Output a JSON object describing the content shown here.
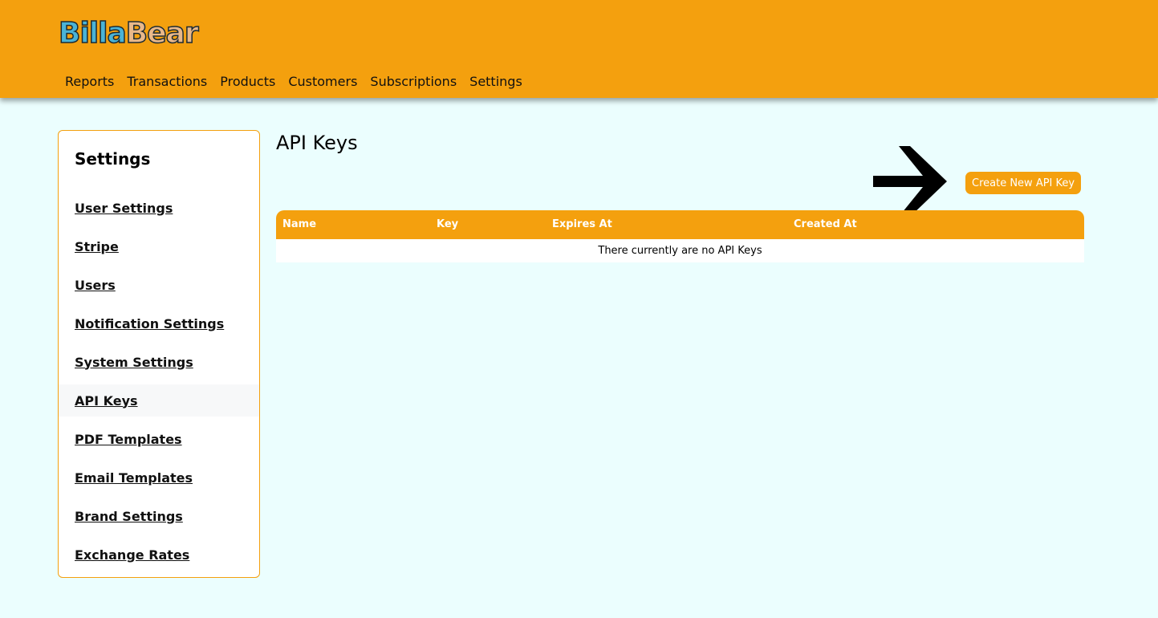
{
  "brand": {
    "logo_part1": "Billa",
    "logo_part2": "Bear"
  },
  "nav": [
    "Reports",
    "Transactions",
    "Products",
    "Customers",
    "Subscriptions",
    "Settings"
  ],
  "sidebar": {
    "title": "Settings",
    "items": [
      {
        "label": "User Settings"
      },
      {
        "label": "Stripe"
      },
      {
        "label": "Users"
      },
      {
        "label": "Notification Settings"
      },
      {
        "label": "System Settings"
      },
      {
        "label": "API Keys",
        "active": true
      },
      {
        "label": "PDF Templates"
      },
      {
        "label": "Email Templates"
      },
      {
        "label": "Brand Settings"
      },
      {
        "label": "Exchange Rates"
      }
    ]
  },
  "main": {
    "title": "API Keys",
    "create_button": "Create New API Key",
    "annotation_icon": "arrow-right-icon",
    "table": {
      "columns": [
        "Name",
        "Key",
        "Expires At",
        "Created At"
      ],
      "empty_message": "There currently are no API Keys"
    }
  },
  "colors": {
    "accent": "#f4a00e",
    "background": "#ebfefe",
    "panel": "#ffffff"
  }
}
